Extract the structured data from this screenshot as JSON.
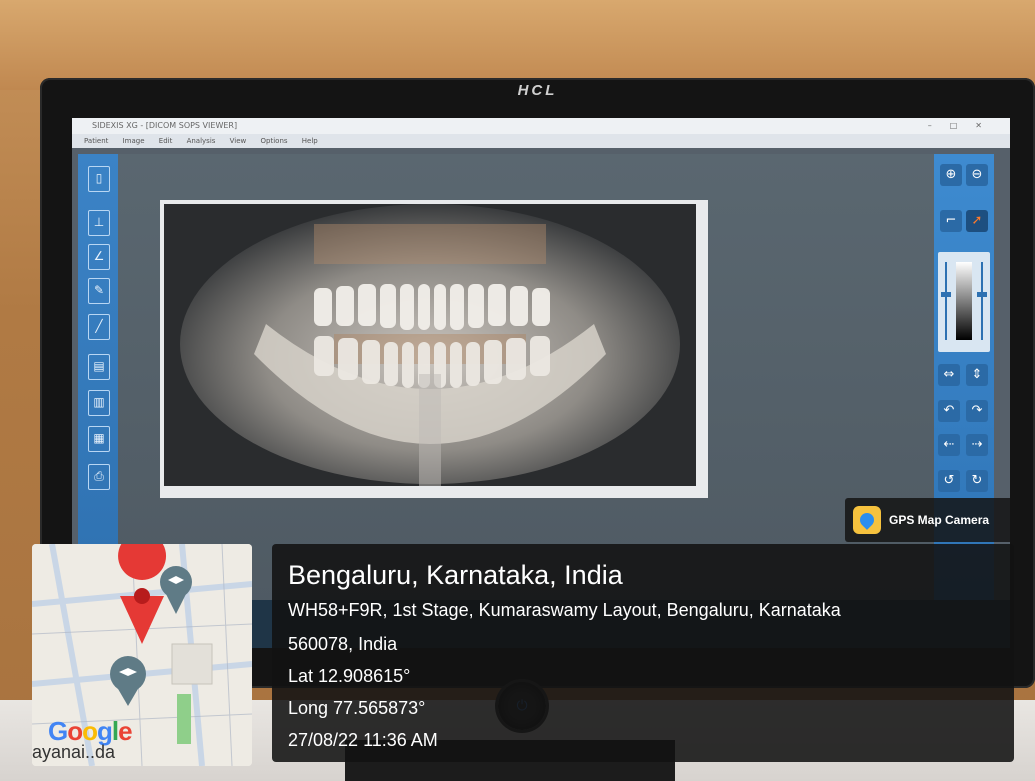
{
  "monitor": {
    "brand": "HCL"
  },
  "app": {
    "title": "SIDEXIS XG - [DICOM SOPS VIEWER]",
    "menu": [
      "Patient",
      "Image",
      "Edit",
      "Analysis",
      "View",
      "Options",
      "Help"
    ]
  },
  "gps_tag": {
    "label": "GPS Map Camera"
  },
  "map": {
    "logo_letters": [
      "G",
      "o",
      "o",
      "g",
      "l",
      "e"
    ],
    "place_fragment": "ayanai..da"
  },
  "location": {
    "title": "Bengaluru, Karnataka, India",
    "address_line1": "WH58+F9R, 1st Stage, Kumaraswamy Layout, Bengaluru, Karnataka",
    "address_line2": "560078, India",
    "lat": "Lat 12.908615°",
    "long": "Long 77.565873°",
    "datetime": "27/08/22 11:36 AM"
  },
  "colors": {
    "toolbar_blue": "#3b83c6",
    "overlay_bg": "#121212",
    "pin_red": "#e53935"
  }
}
